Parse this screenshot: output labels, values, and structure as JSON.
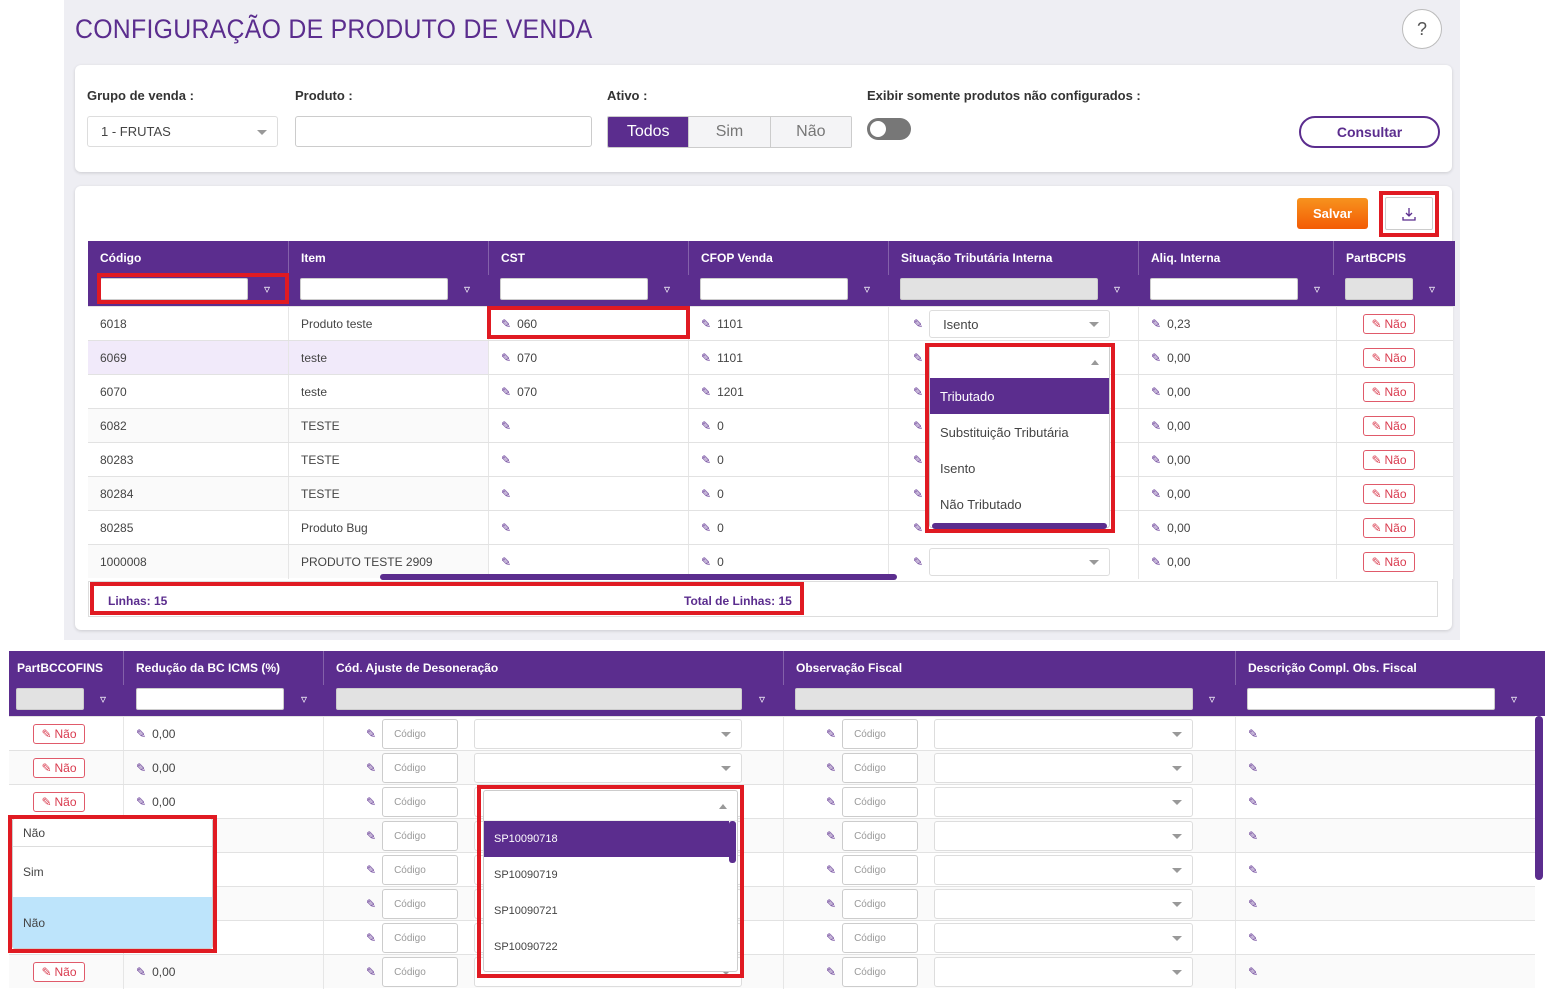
{
  "page": {
    "title": "CONFIGURAÇÃO DE PRODUTO DE VENDA",
    "help": "?"
  },
  "filters": {
    "grupo_label": "Grupo de venda :",
    "grupo_value": "1 - FRUTAS",
    "produto_label": "Produto :",
    "ativo_label": "Ativo :",
    "ativo_options": [
      "Todos",
      "Sim",
      "Não"
    ],
    "exibir_label": "Exibir somente produtos não configurados :",
    "consultar": "Consultar"
  },
  "toolbar": {
    "save": "Salvar",
    "download_icon": "download-icon"
  },
  "grid1": {
    "columns": [
      "Código",
      "Item",
      "CST",
      "CFOP Venda",
      "Situação Tributária Interna",
      "Aliq. Interna",
      "PartBCPIS"
    ],
    "rows": [
      {
        "codigo": "6018",
        "item": "Produto teste",
        "cst": "060",
        "cfop": "1101",
        "sit": "Isento",
        "aliq": "0,23",
        "part": "Não"
      },
      {
        "codigo": "6069",
        "item": "teste",
        "cst": "070",
        "cfop": "1101",
        "sit": "",
        "aliq": "0,00",
        "part": "Não"
      },
      {
        "codigo": "6070",
        "item": "teste",
        "cst": "070",
        "cfop": "1201",
        "sit": "",
        "aliq": "0,00",
        "part": "Não"
      },
      {
        "codigo": "6082",
        "item": "TESTE",
        "cst": "",
        "cfop": "0",
        "sit": "",
        "aliq": "0,00",
        "part": "Não"
      },
      {
        "codigo": "80283",
        "item": "TESTE",
        "cst": "",
        "cfop": "0",
        "sit": "",
        "aliq": "0,00",
        "part": "Não"
      },
      {
        "codigo": "80284",
        "item": "TESTE",
        "cst": "",
        "cfop": "0",
        "sit": "",
        "aliq": "0,00",
        "part": "Não"
      },
      {
        "codigo": "80285",
        "item": "Produto Bug",
        "cst": "",
        "cfop": "0",
        "sit": "",
        "aliq": "0,00",
        "part": "Não"
      },
      {
        "codigo": "1000008",
        "item": "PRODUTO TESTE 2909",
        "cst": "",
        "cfop": "0",
        "sit": "",
        "aliq": "0,00",
        "part": "Não"
      }
    ],
    "situacao_dropdown": [
      "Tributado",
      "Substituição Tributária",
      "Isento",
      "Não Tributado"
    ],
    "footer_lines": "Linhas: 15",
    "footer_total": "Total de Linhas: 15"
  },
  "grid2": {
    "columns": [
      "PartBCCOFINS",
      "Redução da BC ICMS (%)",
      "Cód. Ajuste de Desoneração",
      "Observação Fiscal",
      "Descrição Compl. Obs. Fiscal"
    ],
    "rows": [
      {
        "part": "Não",
        "red": "0,00"
      },
      {
        "part": "Não",
        "red": "0,00"
      },
      {
        "part": "Não",
        "red": "0,00"
      },
      {
        "part": "",
        "red": ""
      },
      {
        "part": "",
        "red": ""
      },
      {
        "part": "",
        "red": ""
      },
      {
        "part": "",
        "red": ""
      },
      {
        "part": "Não",
        "red": "0,00"
      }
    ],
    "codigo_placeholder": "Código",
    "part_dropdown": [
      "Não",
      "Sim",
      "Não"
    ],
    "ajuste_dropdown": [
      "SP10090718",
      "SP10090719",
      "SP10090721",
      "SP10090722"
    ]
  },
  "colors": {
    "primary": "#5b2d8e",
    "highlight": "#e01a22",
    "save": "#f35b04"
  }
}
